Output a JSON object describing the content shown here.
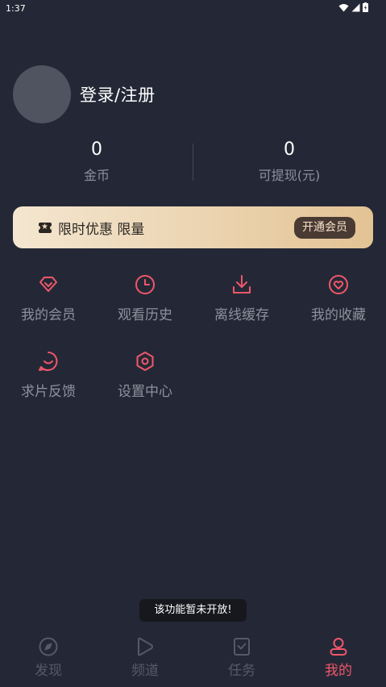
{
  "status_bar": {
    "time": "1:37"
  },
  "profile": {
    "login_label": "登录/注册"
  },
  "stats": [
    {
      "value": "0",
      "label": "金币"
    },
    {
      "value": "0",
      "label": "可提现(元)"
    }
  ],
  "vip_banner": {
    "text": "限时优惠 限量",
    "button": "开通会员"
  },
  "menu": [
    {
      "label": "我的会员",
      "icon": "diamond-icon"
    },
    {
      "label": "观看历史",
      "icon": "clock-icon"
    },
    {
      "label": "离线缓存",
      "icon": "download-icon"
    },
    {
      "label": "我的收藏",
      "icon": "heart-icon"
    },
    {
      "label": "求片反馈",
      "icon": "feedback-icon"
    },
    {
      "label": "设置中心",
      "icon": "settings-icon"
    }
  ],
  "toast": "该功能暂未开放!",
  "tabs": [
    {
      "label": "发现",
      "icon": "compass-icon",
      "active": false
    },
    {
      "label": "频道",
      "icon": "play-icon",
      "active": false
    },
    {
      "label": "任务",
      "icon": "task-icon",
      "active": false
    },
    {
      "label": "我的",
      "icon": "user-icon",
      "active": true
    }
  ],
  "colors": {
    "accent": "#f0576a",
    "background": "#242836",
    "muted_text": "#8d909c",
    "vip_gold": "#e3c394"
  }
}
